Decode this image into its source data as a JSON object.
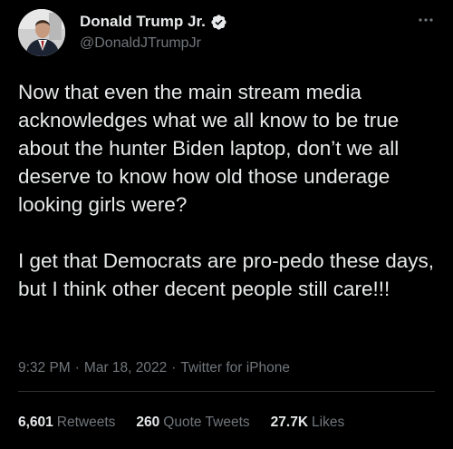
{
  "author": {
    "display_name": "Donald Trump Jr.",
    "handle": "@DonaldJTrumpJr",
    "verified": true,
    "avatar_icon": "profile-photo"
  },
  "tweet": {
    "paragraphs": [
      "Now that even the main stream media acknowledges what we all know to be true about the hunter Biden laptop, don’t we all deserve to know how old those underage looking girls were?",
      "I get that Democrats are pro-pedo these days, but I think other decent people still care!!!"
    ]
  },
  "meta": {
    "time": "9:32 PM",
    "separator": "·",
    "date": "Mar 18, 2022",
    "source": "Twitter for iPhone"
  },
  "stats": {
    "retweets": {
      "count": "6,601",
      "label": "Retweets"
    },
    "quotes": {
      "count": "260",
      "label": "Quote Tweets"
    },
    "likes": {
      "count": "27.7K",
      "label": "Likes"
    }
  },
  "colors": {
    "background": "#000000",
    "text": "#e7e9ea",
    "muted": "#71767b",
    "divider": "#2f3336",
    "verified": "#1d9bf0"
  }
}
